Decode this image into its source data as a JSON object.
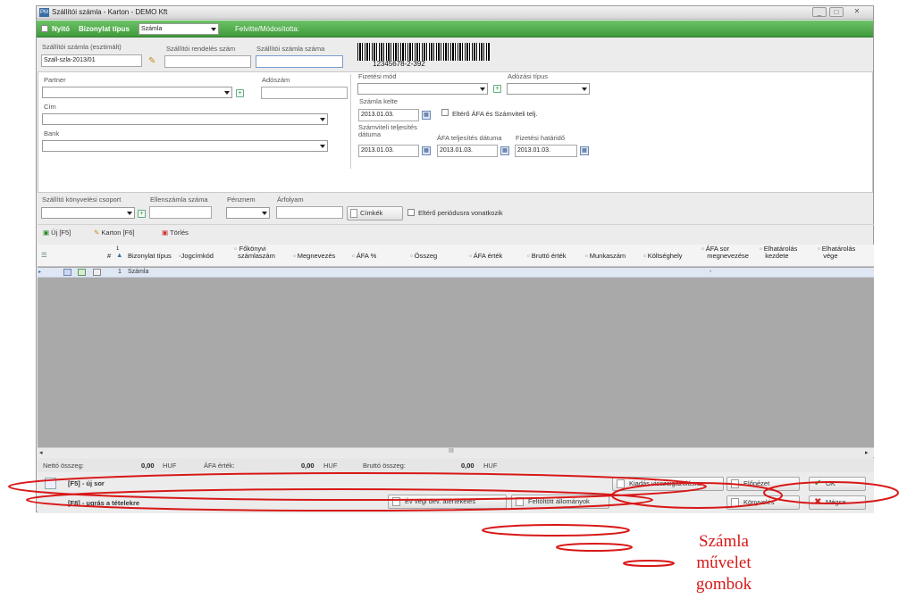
{
  "window": {
    "title": "Szállítói számla - Karton  - DEMO Kft",
    "app_icon": "PM"
  },
  "greenbar": {
    "nyito_label": "Nyitó",
    "doc_type_label": "Bizonylat típus",
    "doc_type_value": "Számla",
    "felvitte_label": "Felvitte/Módosította:"
  },
  "header": {
    "szamla_label": "Szállítói számla (esztimált)",
    "szamla_value": "Szall-szla-2013/01",
    "rendeles_label": "Szállítói rendelés szám",
    "szamlaszam_label": "Szállítói számla száma",
    "barcode_text": "12345678-2-392"
  },
  "form": {
    "partner_label": "Partner",
    "adoszam_label": "Adószám",
    "cim_label": "Cím",
    "bank_label": "Bank",
    "fizmod_label": "Fizetési mód",
    "adozasi_label": "Adózási típus",
    "kelte_label": "Számla kelte",
    "kelte_value": "2013.01.03.",
    "elterő_label": "Eltérő ÁFA és Számviteli telj.",
    "szamv_label_1": "Számviteli teljesítés",
    "szamv_label_2": "dátuma",
    "szamv_value": "2013.01.03.",
    "afa_telj_label": "ÁFA teljesítés dátuma",
    "afa_telj_value": "2013.01.03.",
    "fizhat_label": "Fizetési határidő",
    "fizhat_value": "2013.01.03."
  },
  "lower": {
    "konyv_label": "Szállító könyvelési csoport",
    "ellen_label": "Ellenszámla száma",
    "penznem_label": "Pénznem",
    "arfolyam_label": "Árfolyam",
    "cimkek_label": "Címkék",
    "periodus_label": "Eltérő periódusra vonatkozik"
  },
  "toolbar": {
    "uj": "Új  [F5]",
    "karton": "Karton  [F6]",
    "torles": "Törlés"
  },
  "grid": {
    "headers": [
      "#",
      "Bizonylat típus",
      "Jogcímkód",
      "Főkönyvi",
      "számlaszám",
      "Megnevezés",
      "ÁFA %",
      "Összeg",
      "ÁFA érték",
      "Bruttó érték",
      "Munkaszám",
      "Költséghely",
      "ÁFA sor",
      "megnevezése",
      "Elhatárolás",
      "kezdete",
      "Elhatárolás",
      "vége"
    ],
    "sort_index": "1",
    "row": {
      "num": "1",
      "type": "Számla",
      "dash": "-"
    }
  },
  "totals": {
    "netto_label": "Nettó összeg:",
    "netto_value": "0,00",
    "netto_cur": "HUF",
    "afa_label": "ÁFA érték:",
    "afa_value": "0,00",
    "afa_cur": "HUF",
    "brutto_label": "Bruttó összeg:",
    "brutto_value": "0,00",
    "brutto_cur": "HUF"
  },
  "buttons": {
    "f5": "[F5] - új sor",
    "f8": "[F8] - ugrás a tételekre",
    "kiadas": "Kiadás visszaigazolásra",
    "elonezet": "Előnézet",
    "ok": "OK",
    "evvegi": "Év végi dev. átértékelés",
    "feltoltott": "Feltöltött állományok",
    "konyveles": "Könyvelés",
    "megse": "Mégse"
  },
  "annotation": {
    "line1": "Számla",
    "line2": "művelet",
    "line3": "gombok",
    "color": "#d81818"
  }
}
